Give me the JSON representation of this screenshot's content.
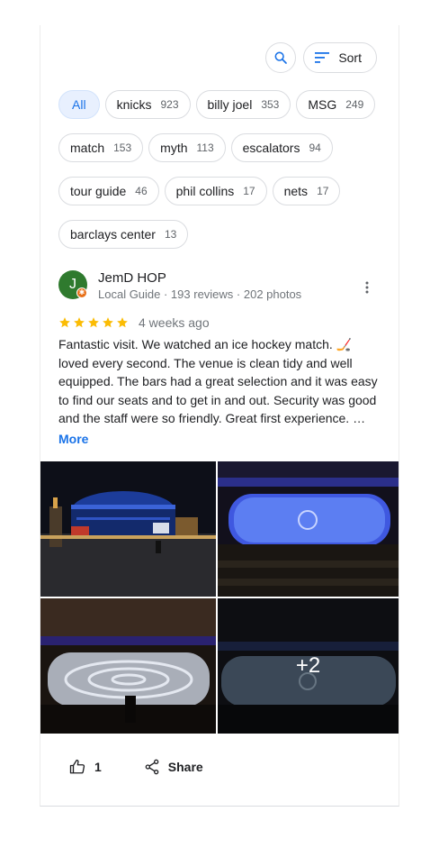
{
  "toolbar": {
    "search_icon": "search-icon",
    "sort_label": "Sort"
  },
  "chips": [
    {
      "label": "All",
      "count": ""
    },
    {
      "label": "knicks",
      "count": "923"
    },
    {
      "label": "billy joel",
      "count": "353"
    },
    {
      "label": "MSG",
      "count": "249"
    },
    {
      "label": "match",
      "count": "153"
    },
    {
      "label": "myth",
      "count": "113"
    },
    {
      "label": "escalators",
      "count": "94"
    },
    {
      "label": "tour guide",
      "count": "46"
    },
    {
      "label": "phil collins",
      "count": "17"
    },
    {
      "label": "nets",
      "count": "17"
    },
    {
      "label": "barclays center",
      "count": "13"
    }
  ],
  "review": {
    "avatar_letter": "J",
    "author": "JemD HOP",
    "meta": "Local Guide · 193 reviews · 202 photos",
    "rating": 5,
    "date": "4 weeks ago",
    "text": "Fantastic visit. We watched an ice hockey match. 🏒 loved every second. The venue is clean tidy and well equipped. The bars had a great selection and it was easy to find our seats and to get in and out. Security was good and the staff were so friendly. Great first experience. …",
    "more_label": "More",
    "photos_extra": "+2",
    "like_count": "1",
    "share_label": "Share"
  },
  "colors": {
    "accent": "#1a73e8",
    "star": "#fbbc04",
    "avatar": "#2f7a2e",
    "badge": "#e8711a"
  }
}
